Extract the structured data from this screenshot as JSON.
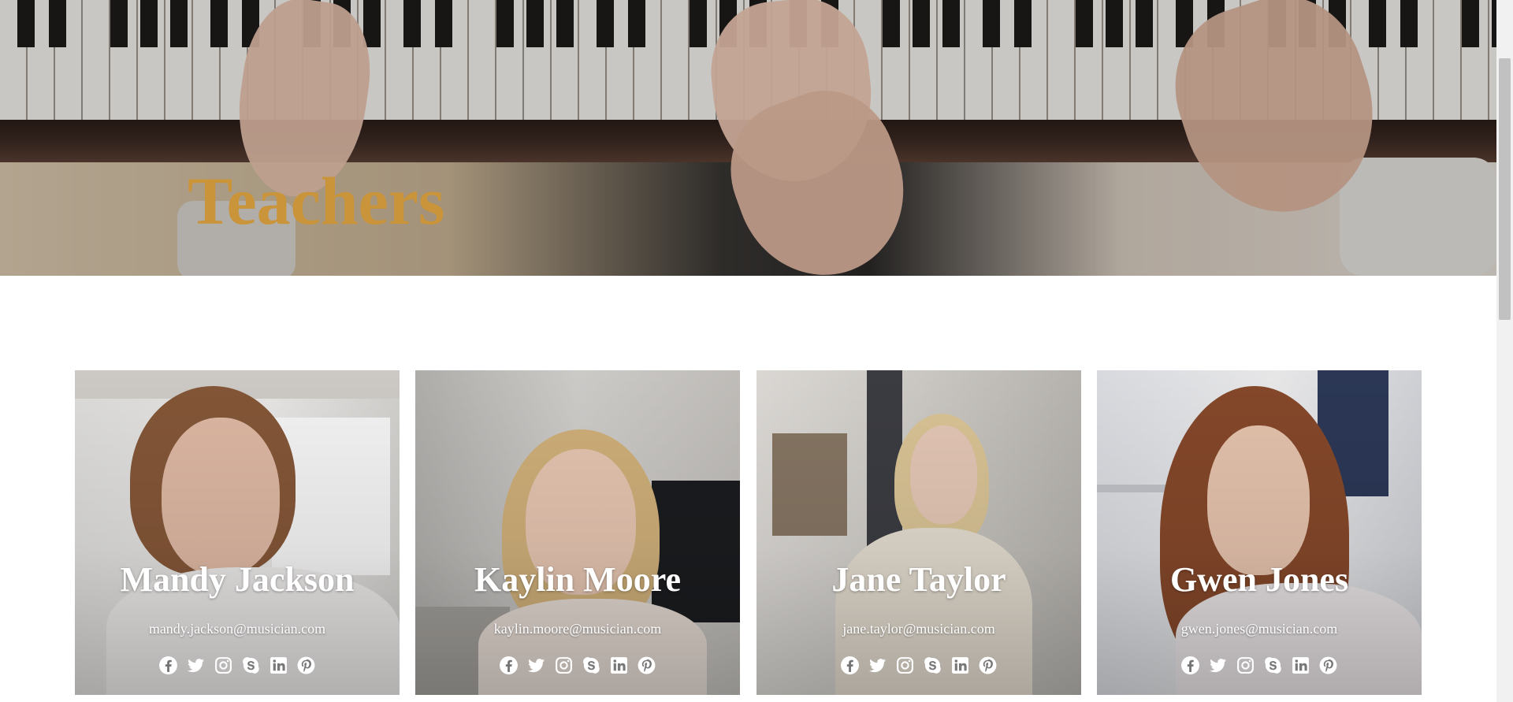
{
  "hero": {
    "title": "Teachers"
  },
  "teachers": [
    {
      "name": "Mandy Jackson",
      "email": "mandy.jackson@musician.com"
    },
    {
      "name": "Kaylin Moore",
      "email": "kaylin.moore@musician.com"
    },
    {
      "name": "Jane Taylor",
      "email": "jane.taylor@musician.com"
    },
    {
      "name": "Gwen Jones",
      "email": "gwen.jones@musician.com"
    }
  ],
  "social_icons": [
    "facebook-icon",
    "twitter-icon",
    "instagram-icon",
    "skype-icon",
    "linkedin-icon",
    "pinterest-icon"
  ],
  "colors": {
    "title_gold": "#c9943a",
    "card_text": "#ffffff",
    "page_background": "#ffffff"
  }
}
